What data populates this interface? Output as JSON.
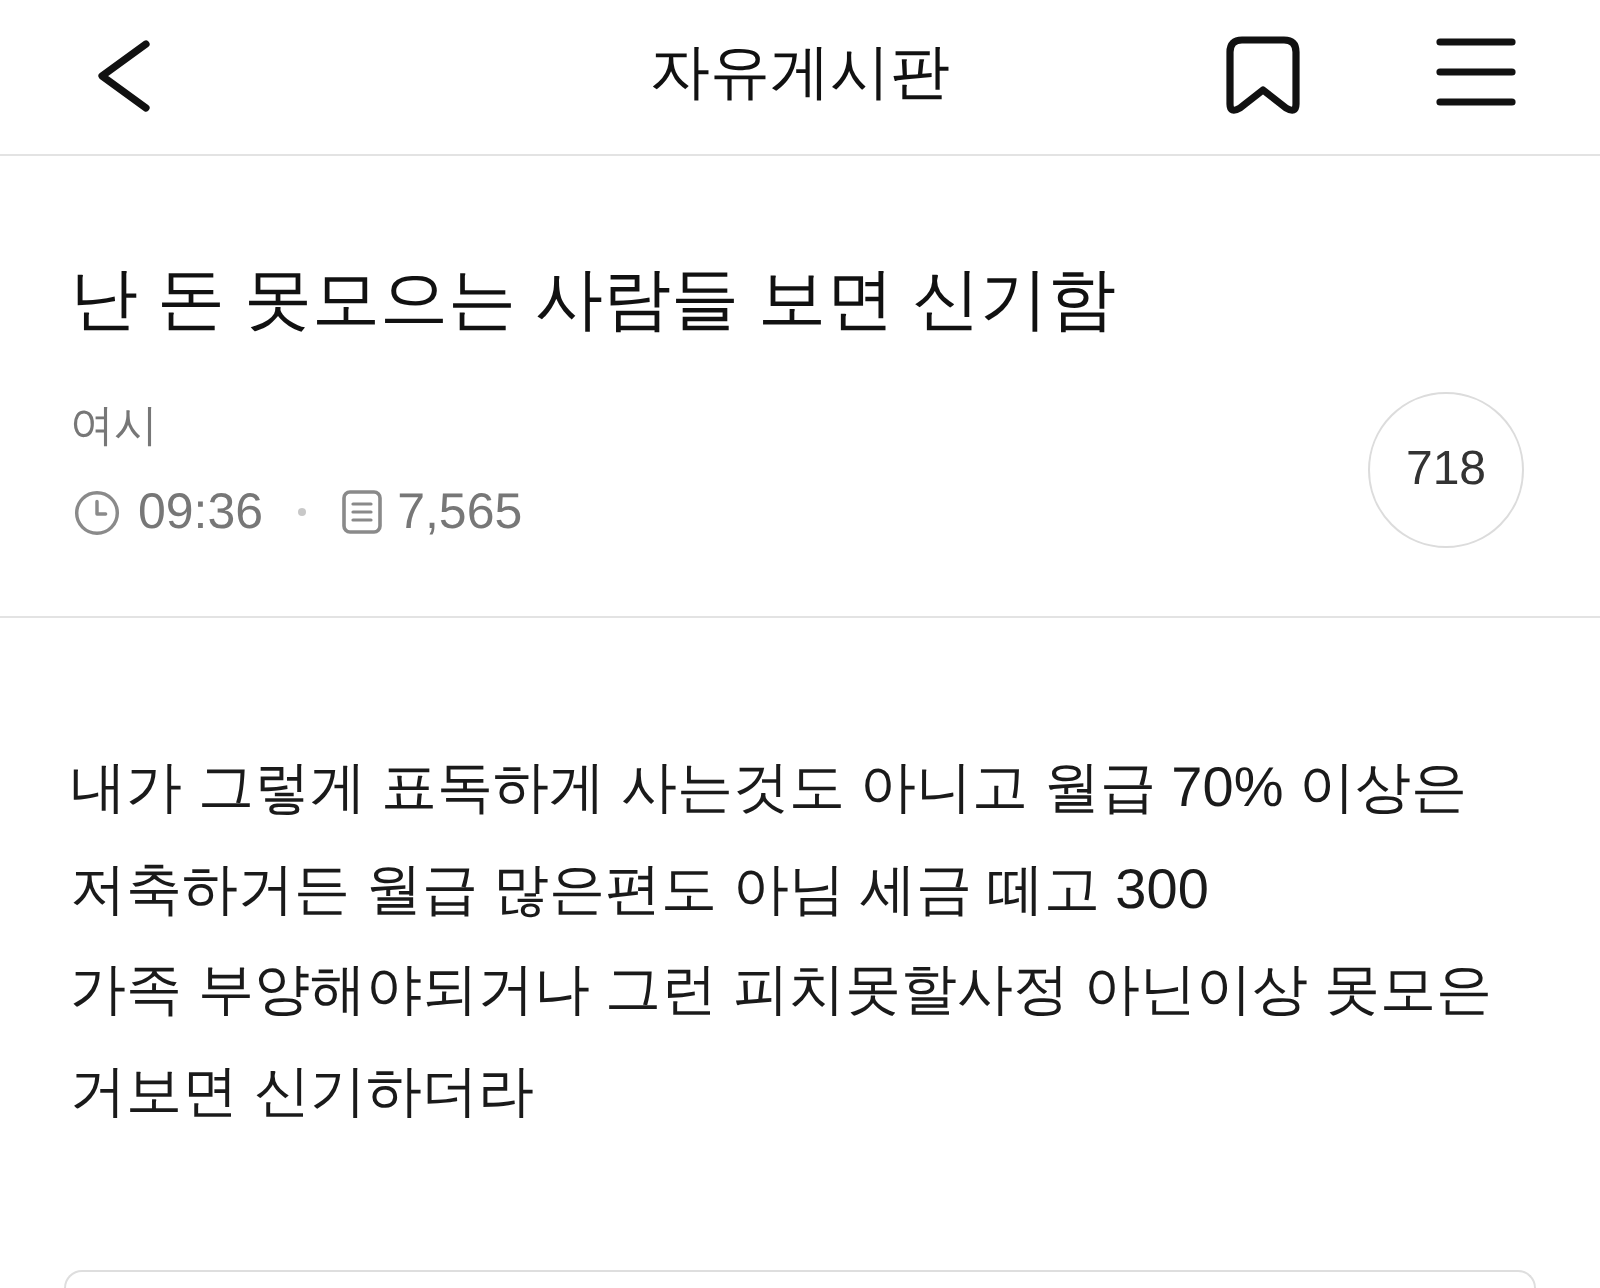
{
  "header": {
    "title": "자유게시판"
  },
  "post": {
    "title": "난 돈 못모으는 사람들 보면 신기함",
    "author": "여시",
    "time": "09:36",
    "views": "7,565",
    "comment_count": "718"
  },
  "body": {
    "text": "내가 그렇게 표독하게 사는것도 아니고 월급 70% 이상은\n저축하거든 월급 많은편도 아님 세금 떼고 300\n가족 부양해야되거나 그런 피치못할사정 아닌이상 못모은\n거보면 신기하더라"
  }
}
